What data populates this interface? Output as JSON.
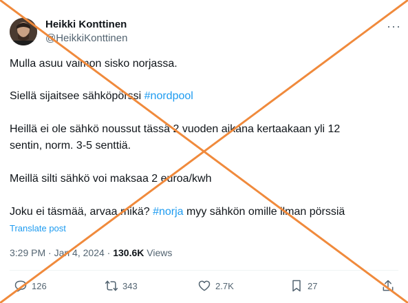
{
  "author": {
    "name": "Heikki Konttinen",
    "handle": "@HeikkiKonttinen"
  },
  "more_label": "···",
  "tweet": {
    "p1": "Mulla asuu vaimon sisko norjassa.",
    "p2_text": "Siellä sijaitsee sähköpörssi ",
    "p2_hashtag": "#nordpool",
    "p3_line1": "Heillä ei ole sähkö noussut tässä 2 vuoden aikana kertaakaan yli 12",
    "p3_line2": "sentin, norm. 3-5 senttiä.",
    "p4": "Meillä silti sähkö voi maksaa 2 euroa/kwh",
    "p5_before": "Joku ei täsmää, arvaa mikä? ",
    "p5_hashtag": "#norja",
    "p5_after": " myy sähkön omille ilman pörssiä"
  },
  "translate_label": "Translate post",
  "meta": {
    "time": "3:29 PM",
    "sep1": " · ",
    "date": "Jan 4, 2024",
    "sep2": " · ",
    "views_count": "130.6K",
    "views_label": " Views"
  },
  "actions": {
    "replies": "126",
    "reposts": "343",
    "likes": "2.7K",
    "bookmarks": "27"
  },
  "colors": {
    "link": "#1d9bf0",
    "muted": "#536471",
    "cross": "#f08a3c"
  }
}
